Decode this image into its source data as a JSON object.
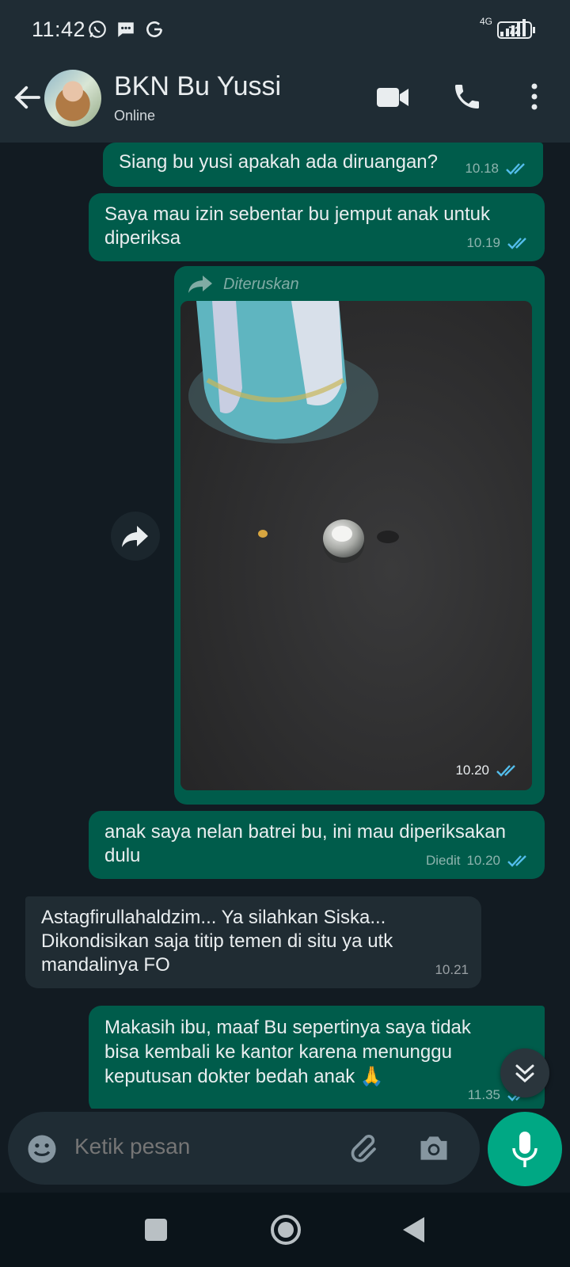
{
  "status_bar": {
    "time": "11:42",
    "network": "4G",
    "battery": "72"
  },
  "header": {
    "contact_name": "BKN Bu Yussi",
    "status": "Online"
  },
  "messages": [
    {
      "text": "Siang bu yusi apakah ada diruangan?",
      "time": "10.18"
    },
    {
      "text": "Saya mau izin sebentar bu jemput anak untuk\ndiperiksa",
      "time": "10.19"
    },
    {
      "forwarded_label": "Diteruskan",
      "time": "10.20"
    },
    {
      "text": "anak saya nelan batrei bu, ini mau diperiksakan\ndulu",
      "edited_label": "Diedit",
      "time": "10.20"
    },
    {
      "text": "Astagfirullahaldzim... Ya silahkan Siska...\nDikondisikan saja titip temen di situ ya utk\nmandalinya FO",
      "time": "10.21"
    },
    {
      "text": "Makasih ibu, maaf Bu sepertinya saya tidak\nbisa kembali ke kantor karena menunggu\nkeputusan dokter bedah anak 🙏",
      "time": "11.35"
    }
  ],
  "composer": {
    "placeholder": "Ketik pesan"
  },
  "colors": {
    "outgoing_bubble": "#005c4b",
    "incoming_bubble": "#202c33",
    "accent": "#00a884",
    "tick_read": "#53bdeb"
  }
}
